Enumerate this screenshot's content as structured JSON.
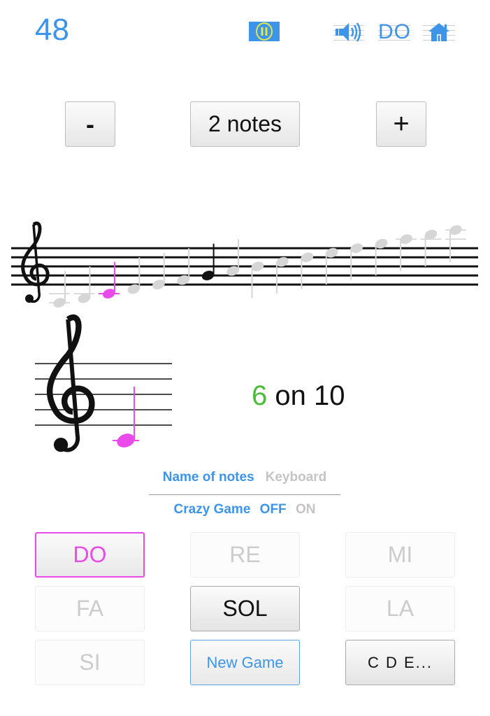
{
  "header": {
    "score_counter": "48",
    "pause_icon": "pause-circle-icon",
    "sound_icon": "speaker-icon",
    "language_label": "DO",
    "home_icon": "home-icon"
  },
  "note_count": {
    "minus_label": "-",
    "value_label": "2 notes",
    "plus_label": "+"
  },
  "range_staff": {
    "clef": "treble",
    "notes": [
      {
        "pitch": "A3",
        "state": "inactive"
      },
      {
        "pitch": "B3",
        "state": "inactive"
      },
      {
        "pitch": "C4",
        "state": "current"
      },
      {
        "pitch": "D4",
        "state": "inactive"
      },
      {
        "pitch": "E4",
        "state": "inactive"
      },
      {
        "pitch": "F4",
        "state": "inactive"
      },
      {
        "pitch": "G4",
        "state": "active"
      },
      {
        "pitch": "A4",
        "state": "inactive"
      },
      {
        "pitch": "B4",
        "state": "inactive"
      },
      {
        "pitch": "C5",
        "state": "inactive"
      },
      {
        "pitch": "D5",
        "state": "inactive"
      },
      {
        "pitch": "E5",
        "state": "inactive"
      },
      {
        "pitch": "F5",
        "state": "inactive"
      },
      {
        "pitch": "G5",
        "state": "inactive"
      },
      {
        "pitch": "A5",
        "state": "inactive"
      },
      {
        "pitch": "B5",
        "state": "inactive"
      },
      {
        "pitch": "C6",
        "state": "inactive"
      }
    ]
  },
  "question": {
    "clef": "treble",
    "note": "C4"
  },
  "result": {
    "correct": "6",
    "separator": " on ",
    "total": "10"
  },
  "mode": {
    "name_of_notes": "Name of notes",
    "keyboard": "Keyboard",
    "selected": "Name of notes"
  },
  "crazy_game": {
    "label": "Crazy Game",
    "off": "OFF",
    "on": "ON",
    "selected": "OFF"
  },
  "answers": [
    {
      "label": "DO",
      "state": "selected"
    },
    {
      "label": "RE",
      "state": "disabled"
    },
    {
      "label": "MI",
      "state": "disabled"
    },
    {
      "label": "FA",
      "state": "disabled"
    },
    {
      "label": "SOL",
      "state": "normal"
    },
    {
      "label": "LA",
      "state": "disabled"
    },
    {
      "label": "SI",
      "state": "disabled"
    }
  ],
  "actions": {
    "new_game": "New Game",
    "notation": "C D E..."
  },
  "colors": {
    "accent": "#3d94e8",
    "current_note": "#e94ae9",
    "correct": "#4cbb3c",
    "inactive_note": "#d6d6d6"
  }
}
